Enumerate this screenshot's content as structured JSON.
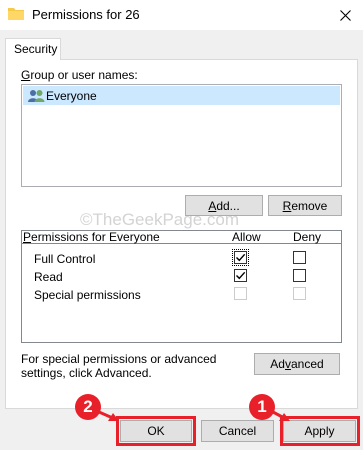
{
  "window": {
    "title": "Permissions for 26"
  },
  "tabs": [
    {
      "label": "Security"
    }
  ],
  "group_section": {
    "label_accel": "G",
    "label_rest": "roup or user names:",
    "users": [
      {
        "name": "Everyone",
        "icon": "users-icon",
        "selected": true
      }
    ]
  },
  "buttons": {
    "add_accel": "A",
    "add_rest": "dd...",
    "remove_accel": "R",
    "remove_rest": "emove",
    "advanced_pre": "Ad",
    "advanced_accel": "v",
    "advanced_post": "anced",
    "ok": "OK",
    "cancel": "Cancel",
    "apply": "Apply"
  },
  "permissions": {
    "title_accel": "P",
    "title_rest": "ermissions for Everyone",
    "allow_header": "Allow",
    "deny_header": "Deny",
    "rows": [
      {
        "name": "Full Control",
        "allow": true,
        "deny": false,
        "enabled": true
      },
      {
        "name": "Read",
        "allow": true,
        "deny": false,
        "enabled": true
      },
      {
        "name": "Special permissions",
        "allow": false,
        "deny": false,
        "enabled": false
      }
    ]
  },
  "special_note": "For special permissions or advanced settings, click Advanced.",
  "watermark": "©TheGeekPage.com",
  "annotations": [
    {
      "number": "1",
      "target": "Apply"
    },
    {
      "number": "2",
      "target": "OK"
    }
  ],
  "colors": {
    "annotation": "#e8202a",
    "selection": "#cce8ff"
  }
}
